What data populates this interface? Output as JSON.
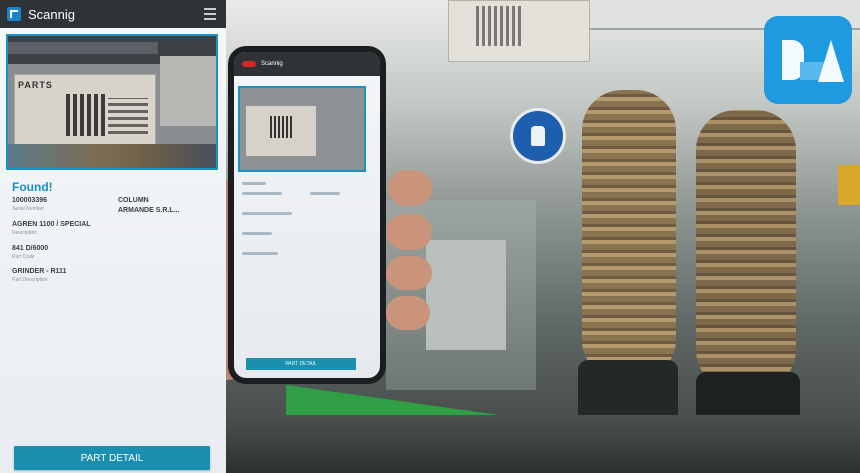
{
  "app": {
    "title": "Scannig",
    "status": "Found!",
    "button_label": "PART DETAIL"
  },
  "fields": [
    {
      "value": "100003396",
      "label": "Serial Number"
    },
    {
      "value": "COLUMN",
      "label": "ARMANDE S.R.L..."
    },
    {
      "value": "AGREN 1100 / SPECIAL",
      "label": "Description"
    },
    {
      "value": "841 D/6000",
      "label": "Part Code"
    },
    {
      "value": "GRINDER - R111",
      "label": "Part Description"
    }
  ],
  "camera": {
    "label_text": "PARTS"
  },
  "phone": {
    "title": "Scannig",
    "button_label": "PART DETAIL"
  },
  "colors": {
    "accent": "#1b8fb0",
    "header": "#2f3338",
    "found": "#1b8fc6",
    "logo": "#1e9be0"
  }
}
